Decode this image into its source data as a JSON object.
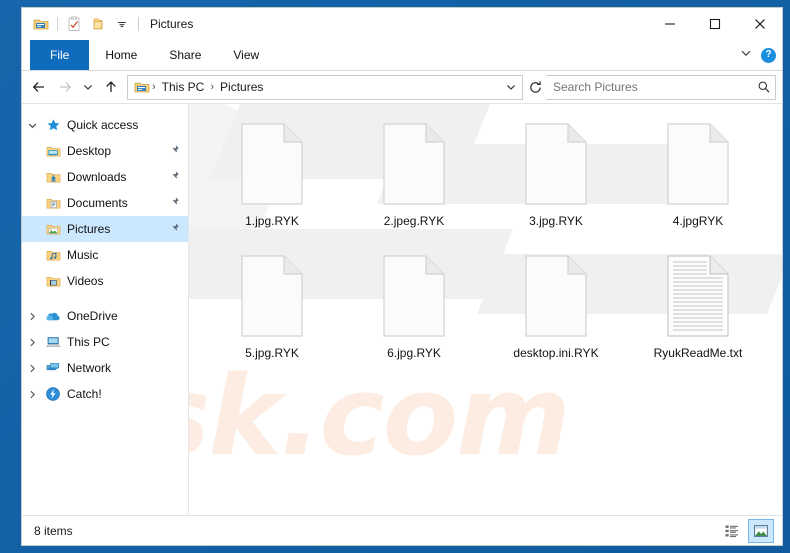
{
  "window": {
    "title": "Pictures",
    "quick_access_toolbar": [
      {
        "name": "explorer-properties-icon",
        "label": "Properties"
      },
      {
        "name": "new-folder-icon",
        "label": "New folder"
      },
      {
        "name": "customize-qat-chevron-icon",
        "label": "Customize Quick Access Toolbar"
      }
    ],
    "controls": {
      "minimize": "─",
      "maximize": "☐",
      "close": "✕"
    }
  },
  "ribbon": {
    "tabs": [
      {
        "label": "File",
        "active": true
      },
      {
        "label": "Home",
        "active": false
      },
      {
        "label": "Share",
        "active": false
      },
      {
        "label": "View",
        "active": false
      }
    ],
    "collapse_label": "⌄",
    "help_label": "?"
  },
  "address": {
    "back_label": "←",
    "forward_label": "→",
    "recent_label": "⌄",
    "up_label": "↑",
    "breadcrumbs": [
      "This PC",
      "Pictures"
    ],
    "separator": "›",
    "dropdown_label": "⌄",
    "refresh_label": "↻"
  },
  "search": {
    "placeholder": "Search Pictures",
    "icon": "search-icon"
  },
  "sidebar": {
    "groups": [
      {
        "name": "quick-access",
        "label": "Quick access",
        "icon": "star-icon",
        "expanded": true,
        "chevron": "⌄",
        "items": [
          {
            "label": "Desktop",
            "icon": "folder-desktop-icon",
            "pinned": true,
            "selected": false
          },
          {
            "label": "Downloads",
            "icon": "folder-downloads-icon",
            "pinned": true,
            "selected": false
          },
          {
            "label": "Documents",
            "icon": "folder-documents-icon",
            "pinned": true,
            "selected": false
          },
          {
            "label": "Pictures",
            "icon": "folder-pictures-icon",
            "pinned": true,
            "selected": true
          },
          {
            "label": "Music",
            "icon": "folder-music-icon",
            "pinned": false,
            "selected": false
          },
          {
            "label": "Videos",
            "icon": "folder-videos-icon",
            "pinned": false,
            "selected": false
          }
        ]
      }
    ],
    "roots": [
      {
        "label": "OneDrive",
        "icon": "onedrive-cloud-icon",
        "chevron": "›"
      },
      {
        "label": "This PC",
        "icon": "this-pc-icon",
        "chevron": "›"
      },
      {
        "label": "Network",
        "icon": "network-icon",
        "chevron": "›"
      },
      {
        "label": "Catch!",
        "icon": "catch-icon",
        "chevron": "›"
      }
    ]
  },
  "files": [
    {
      "name": "1.jpg.RYK",
      "icon": "blank-file-icon"
    },
    {
      "name": "2.jpeg.RYK",
      "icon": "blank-file-icon"
    },
    {
      "name": "3.jpg.RYK",
      "icon": "blank-file-icon"
    },
    {
      "name": "4.jpgRYK",
      "icon": "blank-file-icon"
    },
    {
      "name": "5.jpg.RYK",
      "icon": "blank-file-icon"
    },
    {
      "name": "6.jpg.RYK",
      "icon": "blank-file-icon"
    },
    {
      "name": "desktop.ini.RYK",
      "icon": "blank-file-icon"
    },
    {
      "name": "RyukReadMe.txt",
      "icon": "text-file-icon"
    }
  ],
  "status": {
    "item_count": "8 items",
    "views": [
      {
        "name": "details-view-button",
        "active": false
      },
      {
        "name": "large-icons-view-button",
        "active": true
      }
    ]
  },
  "watermark": {
    "text": "sk.com",
    "color": "#fdece2"
  },
  "colors": {
    "accent": "#0f6cbd",
    "selection": "#cce8ff",
    "frame": "#1766ab",
    "folder_yellow": "#ffd179"
  }
}
